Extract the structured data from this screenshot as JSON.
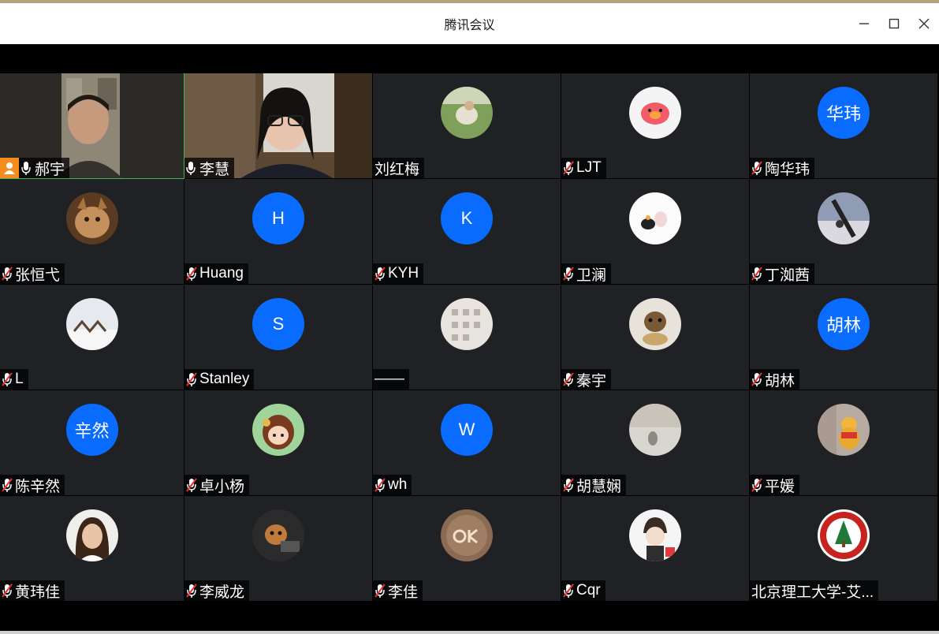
{
  "window": {
    "title": "腾讯会议"
  },
  "participants": [
    {
      "name": "郝宇",
      "mic": "on",
      "video": true,
      "host_badge": true
    },
    {
      "name": "李慧",
      "mic": "on",
      "video": true
    },
    {
      "name": "刘红梅",
      "mic": "none",
      "avatar": "photo"
    },
    {
      "name": "LJT",
      "mic": "muted",
      "avatar": "photo"
    },
    {
      "name": "陶华玮",
      "mic": "muted",
      "avatar_text": "华玮"
    },
    {
      "name": "张恒弋",
      "mic": "muted",
      "avatar": "photo"
    },
    {
      "name": "Huang",
      "mic": "muted",
      "avatar_text": "H"
    },
    {
      "name": "KYH",
      "mic": "muted",
      "avatar_text": "K"
    },
    {
      "name": "卫澜",
      "mic": "muted",
      "avatar": "photo"
    },
    {
      "name": "丁洳茜",
      "mic": "muted",
      "avatar": "photo"
    },
    {
      "name": "L",
      "mic": "muted",
      "avatar": "photo"
    },
    {
      "name": "Stanley",
      "mic": "muted",
      "avatar_text": "S"
    },
    {
      "name": "——",
      "mic": "none",
      "avatar": "photo"
    },
    {
      "name": "秦宇",
      "mic": "muted",
      "avatar": "photo"
    },
    {
      "name": "胡林",
      "mic": "muted",
      "avatar_text": "胡林"
    },
    {
      "name": "陈辛然",
      "mic": "muted",
      "avatar_text": "辛然"
    },
    {
      "name": "卓小杨",
      "mic": "muted",
      "avatar": "photo"
    },
    {
      "name": "wh",
      "mic": "muted",
      "avatar_text": "W"
    },
    {
      "name": "胡慧娴",
      "mic": "muted",
      "avatar": "photo"
    },
    {
      "name": "平媛",
      "mic": "muted",
      "avatar": "photo"
    },
    {
      "name": "黄玮佳",
      "mic": "muted",
      "avatar": "photo"
    },
    {
      "name": "李威龙",
      "mic": "muted",
      "avatar": "photo"
    },
    {
      "name": "李佳",
      "mic": "muted",
      "avatar": "photo"
    },
    {
      "name": "Cqr",
      "mic": "muted",
      "avatar": "photo"
    },
    {
      "name": "北京理工大学-艾...",
      "mic": "none",
      "avatar": "photo"
    }
  ],
  "colors": {
    "tile_bg": "#1f2124",
    "avatar_blue": "#0a6cff",
    "muted_red": "#e5312f",
    "active_border": "#3fb34f",
    "host_badge": "#f68c1e"
  }
}
